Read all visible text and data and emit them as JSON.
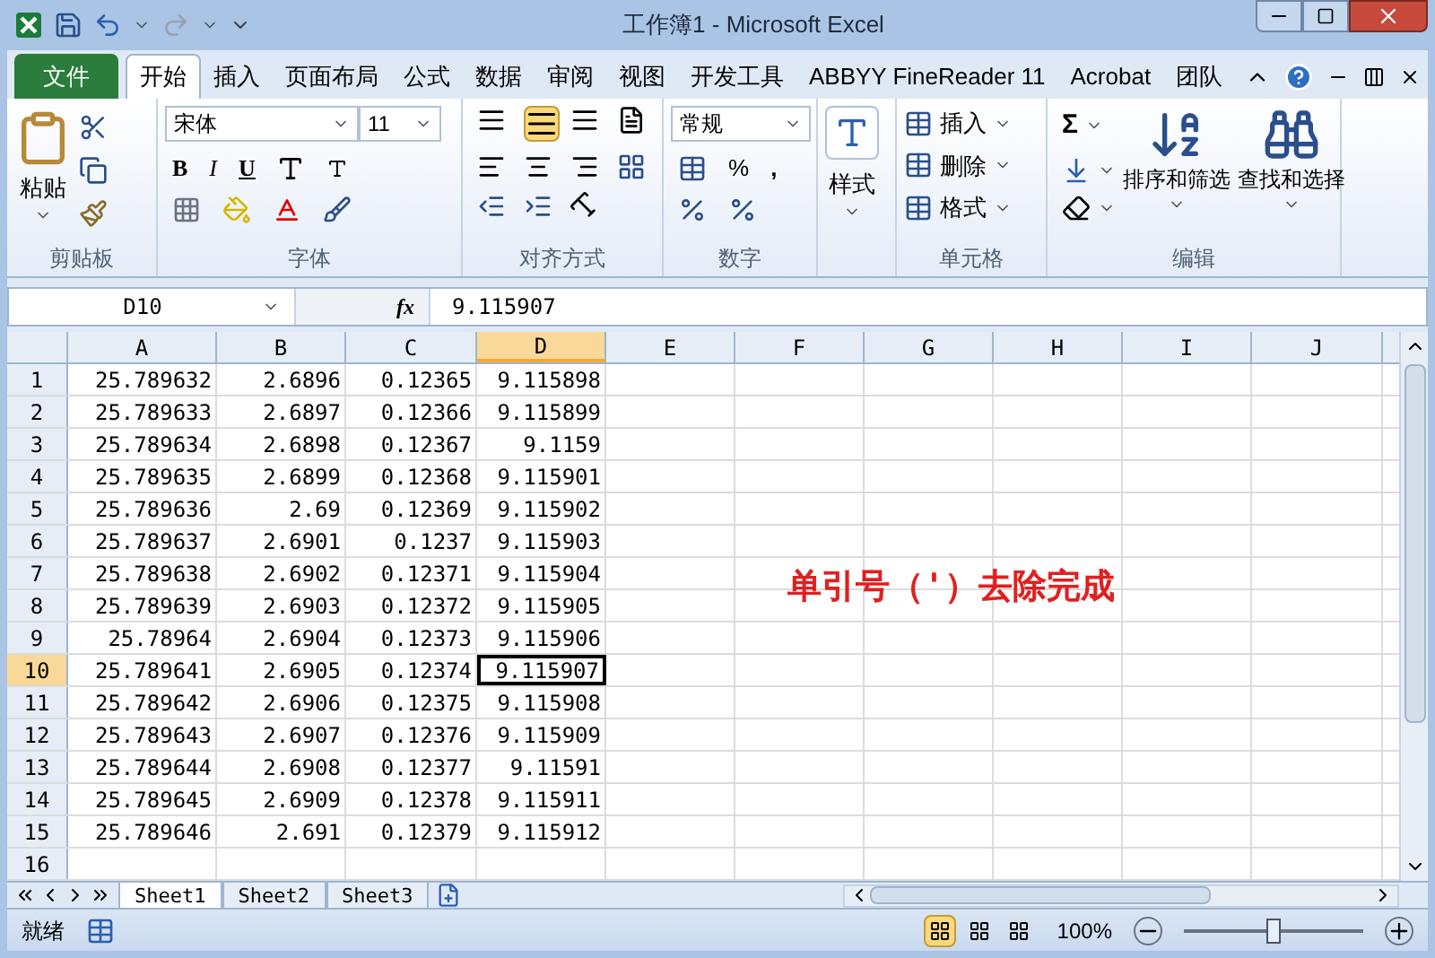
{
  "window": {
    "title": "工作簿1  -  Microsoft Excel"
  },
  "file_tab": {
    "label": "文件"
  },
  "tabs": [
    {
      "label": "开始",
      "selected": true
    },
    {
      "label": "插入",
      "selected": false
    },
    {
      "label": "页面布局",
      "selected": false
    },
    {
      "label": "公式",
      "selected": false
    },
    {
      "label": "数据",
      "selected": false
    },
    {
      "label": "审阅",
      "selected": false
    },
    {
      "label": "视图",
      "selected": false
    },
    {
      "label": "开发工具",
      "selected": false
    },
    {
      "label": "ABBYY FineReader 11",
      "selected": false
    },
    {
      "label": "Acrobat",
      "selected": false
    },
    {
      "label": "团队",
      "selected": false
    }
  ],
  "ribbon": {
    "clipboard": {
      "title": "剪贴板",
      "paste": "粘贴"
    },
    "font": {
      "title": "字体",
      "font_name": "宋体",
      "font_size": "11",
      "bold": "B",
      "italic": "I",
      "underline": "U"
    },
    "alignment": {
      "title": "对齐方式",
      "middle_align_selected": true
    },
    "number": {
      "title": "数字",
      "format": "常规",
      "percent": "%",
      "comma": ","
    },
    "styles": {
      "label": "样式"
    },
    "cells": {
      "title": "单元格",
      "items": [
        "插入",
        "删除",
        "格式"
      ]
    },
    "editing": {
      "title": "编辑",
      "sum": "Σ",
      "sort": "排序和筛选",
      "find": "查找和选择"
    }
  },
  "formula_bar": {
    "name_box": "D10",
    "fx": "fx",
    "value": "9.115907"
  },
  "columns": [
    {
      "label": "A",
      "selected": false
    },
    {
      "label": "B",
      "selected": false
    },
    {
      "label": "C",
      "selected": false
    },
    {
      "label": "D",
      "selected": true
    },
    {
      "label": "E",
      "selected": false
    },
    {
      "label": "F",
      "selected": false
    },
    {
      "label": "G",
      "selected": false
    },
    {
      "label": "H",
      "selected": false
    },
    {
      "label": "I",
      "selected": false
    },
    {
      "label": "J",
      "selected": false
    }
  ],
  "rows": [
    {
      "number": "1",
      "selected": false,
      "cells": [
        "25.789632",
        "2.6896",
        "0.12365",
        "9.115898"
      ]
    },
    {
      "number": "2",
      "selected": false,
      "cells": [
        "25.789633",
        "2.6897",
        "0.12366",
        "9.115899"
      ]
    },
    {
      "number": "3",
      "selected": false,
      "cells": [
        "25.789634",
        "2.6898",
        "0.12367",
        "9.1159"
      ]
    },
    {
      "number": "4",
      "selected": false,
      "cells": [
        "25.789635",
        "2.6899",
        "0.12368",
        "9.115901"
      ]
    },
    {
      "number": "5",
      "selected": false,
      "cells": [
        "25.789636",
        "2.69",
        "0.12369",
        "9.115902"
      ]
    },
    {
      "number": "6",
      "selected": false,
      "cells": [
        "25.789637",
        "2.6901",
        "0.1237",
        "9.115903"
      ]
    },
    {
      "number": "7",
      "selected": false,
      "cells": [
        "25.789638",
        "2.6902",
        "0.12371",
        "9.115904"
      ]
    },
    {
      "number": "8",
      "selected": false,
      "cells": [
        "25.789639",
        "2.6903",
        "0.12372",
        "9.115905"
      ]
    },
    {
      "number": "9",
      "selected": false,
      "cells": [
        "25.78964",
        "2.6904",
        "0.12373",
        "9.115906"
      ]
    },
    {
      "number": "10",
      "selected": true,
      "cells": [
        "25.789641",
        "2.6905",
        "0.12374",
        "9.115907"
      ]
    },
    {
      "number": "11",
      "selected": false,
      "cells": [
        "25.789642",
        "2.6906",
        "0.12375",
        "9.115908"
      ]
    },
    {
      "number": "12",
      "selected": false,
      "cells": [
        "25.789643",
        "2.6907",
        "0.12376",
        "9.115909"
      ]
    },
    {
      "number": "13",
      "selected": false,
      "cells": [
        "25.789644",
        "2.6908",
        "0.12377",
        "9.11591"
      ]
    },
    {
      "number": "14",
      "selected": false,
      "cells": [
        "25.789645",
        "2.6909",
        "0.12378",
        "9.115911"
      ]
    },
    {
      "number": "15",
      "selected": false,
      "cells": [
        "25.789646",
        "2.691",
        "0.12379",
        "9.115912"
      ]
    },
    {
      "number": "16",
      "selected": false,
      "cells": []
    }
  ],
  "annotation": "单引号（'）去除完成",
  "sheet_tabs": [
    {
      "label": "Sheet1",
      "selected": true
    },
    {
      "label": "Sheet2",
      "selected": false
    },
    {
      "label": "Sheet3",
      "selected": false
    }
  ],
  "status_bar": {
    "text": "就绪",
    "views": [
      {
        "selected": true
      },
      {
        "selected": false
      },
      {
        "selected": false
      }
    ],
    "zoom": "100%",
    "zoom_slider": {
      "level": 0.5
    }
  }
}
